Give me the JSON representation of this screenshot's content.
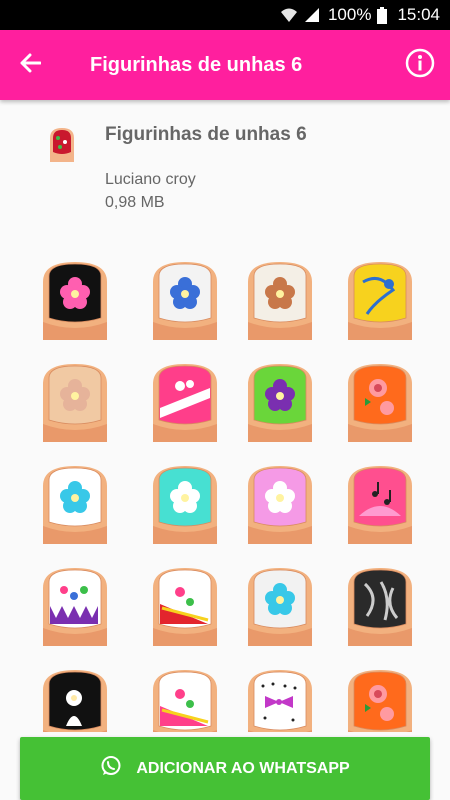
{
  "status_bar": {
    "battery_percent": "100%",
    "time": "15:04",
    "icons": [
      "wifi-icon",
      "signal-icon",
      "battery-icon"
    ]
  },
  "app_bar": {
    "title": "Figurinhas de unhas 6",
    "back_icon": "arrow-back-icon",
    "info_icon": "info-icon",
    "background_color": "#ff1f9e"
  },
  "pack": {
    "name": "Figurinhas de unhas 6",
    "author": "Luciano croy",
    "size": "0,98 MB"
  },
  "stickers": [
    {
      "nail": "#111111",
      "accent": "#ff5fb0",
      "design": "flower"
    },
    {
      "nail": "#f3f3f3",
      "accent": "#3a6fd8",
      "design": "flower"
    },
    {
      "nail": "#f4efe6",
      "accent": "#c8784a",
      "design": "flower"
    },
    {
      "nail": "#f7d21e",
      "accent": "#2b6fd0",
      "design": "swirl"
    },
    {
      "nail": "#f1c9a3",
      "accent": "#e6b39a",
      "design": "flower"
    },
    {
      "nail": "#ff3e8a",
      "accent": "#ffffff",
      "design": "stripe"
    },
    {
      "nail": "#6ad63a",
      "accent": "#7a2fb0",
      "design": "flower"
    },
    {
      "nail": "#ff6a1c",
      "accent": "#ff9aa0",
      "design": "rose"
    },
    {
      "nail": "#ffffff",
      "accent": "#38c8e8",
      "design": "flower"
    },
    {
      "nail": "#47e0d2",
      "accent": "#ffffff",
      "design": "flower"
    },
    {
      "nail": "#f59ae6",
      "accent": "#ffffff",
      "design": "flower"
    },
    {
      "nail": "#ff4f8f",
      "accent": "#222222",
      "design": "notes"
    },
    {
      "nail": "#ffffff",
      "accent": "#ff3f8a",
      "design": "hearts"
    },
    {
      "nail": "#ffffff",
      "accent": "#e3252d",
      "design": "corner"
    },
    {
      "nail": "#f2f2f2",
      "accent": "#38c8e8",
      "design": "flower"
    },
    {
      "nail": "#2a2a2a",
      "accent": "#cccccc",
      "design": "animal"
    },
    {
      "nail": "#111111",
      "accent": "#ffffff",
      "design": "dots"
    },
    {
      "nail": "#ffffff",
      "accent": "#ff3f8a",
      "design": "corner"
    },
    {
      "nail": "#ffffff",
      "accent": "#c238c8",
      "design": "bow"
    },
    {
      "nail": "#ff6a1c",
      "accent": "#ff9aa0",
      "design": "rose"
    }
  ],
  "add_button": {
    "label": "ADICIONAR AO WHATSAPP",
    "icon": "whatsapp-icon",
    "color": "#45c135"
  }
}
